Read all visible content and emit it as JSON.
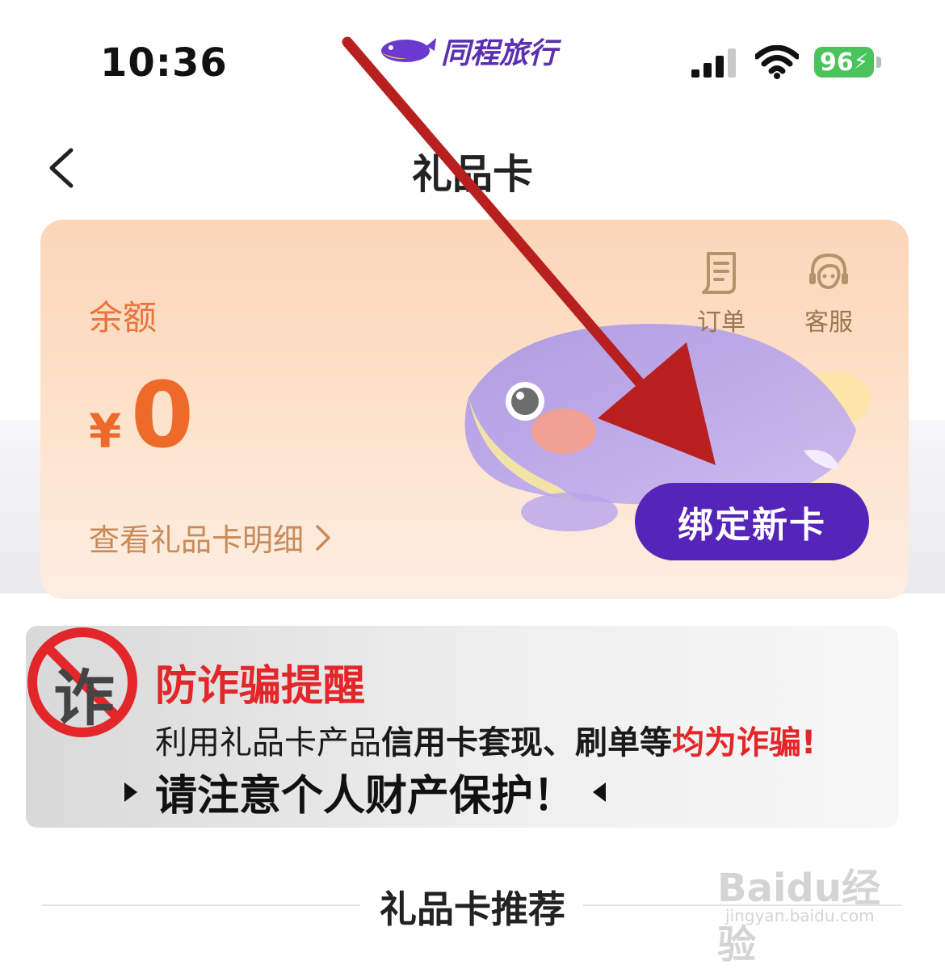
{
  "status_bar": {
    "time": "10:36",
    "brand_name": "同程旅行",
    "battery": "96"
  },
  "nav": {
    "title": "礼品卡"
  },
  "card": {
    "balance_label": "余额",
    "currency": "¥",
    "amount": "0",
    "detail_link": "查看礼品卡明细",
    "quick_actions": {
      "orders": "订单",
      "service": "客服"
    },
    "bind_button": "绑定新卡"
  },
  "fraud_banner": {
    "badge_char": "诈",
    "title": "防诈骗提醒",
    "line1_normal": "利用礼品卡产品",
    "line1_bold": "信用卡套现、刷单等",
    "line1_red": "均为诈骗!",
    "line2": "请注意个人财产保护！"
  },
  "recommend": {
    "title": "礼品卡推荐"
  },
  "watermark": {
    "main": "Baidu经验",
    "sub": "jingyan.baidu.com"
  },
  "colors": {
    "accent": "#5524b8",
    "orange": "#ee6a2a",
    "alert_red": "#e3262a"
  }
}
